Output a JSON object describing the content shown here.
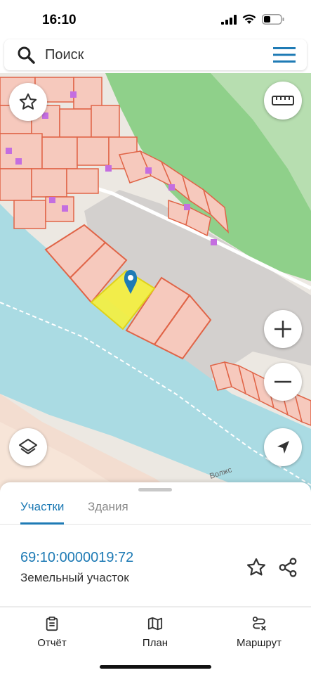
{
  "status_bar": {
    "time": "16:10"
  },
  "search": {
    "placeholder": "Поиск"
  },
  "map": {
    "road_label": "Волжс"
  },
  "tabs": [
    {
      "label": "Участки",
      "active": true
    },
    {
      "label": "Здания",
      "active": false
    }
  ],
  "parcel": {
    "cadastral_number": "69:10:0000019:72",
    "type": "Земельный участок"
  },
  "bottom_nav": [
    {
      "label": "Отчёт",
      "icon": "clipboard-icon"
    },
    {
      "label": "План",
      "icon": "map-icon"
    },
    {
      "label": "Маршрут",
      "icon": "route-icon"
    }
  ],
  "colors": {
    "accent": "#1f7bb5",
    "water": "#aadbe3",
    "parcel_fill": "#f6c9bd",
    "parcel_stroke": "#e06447",
    "selected_parcel": "#f5ef3c",
    "forest": "#8fd08a"
  }
}
